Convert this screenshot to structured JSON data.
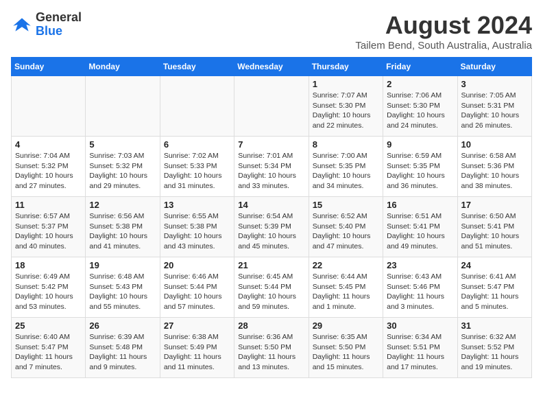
{
  "header": {
    "logo_line1": "General",
    "logo_line2": "Blue",
    "main_title": "August 2024",
    "subtitle": "Tailem Bend, South Australia, Australia"
  },
  "calendar": {
    "days_of_week": [
      "Sunday",
      "Monday",
      "Tuesday",
      "Wednesday",
      "Thursday",
      "Friday",
      "Saturday"
    ],
    "weeks": [
      [
        {
          "day": "",
          "info": ""
        },
        {
          "day": "",
          "info": ""
        },
        {
          "day": "",
          "info": ""
        },
        {
          "day": "",
          "info": ""
        },
        {
          "day": "1",
          "info": "Sunrise: 7:07 AM\nSunset: 5:30 PM\nDaylight: 10 hours\nand 22 minutes."
        },
        {
          "day": "2",
          "info": "Sunrise: 7:06 AM\nSunset: 5:30 PM\nDaylight: 10 hours\nand 24 minutes."
        },
        {
          "day": "3",
          "info": "Sunrise: 7:05 AM\nSunset: 5:31 PM\nDaylight: 10 hours\nand 26 minutes."
        }
      ],
      [
        {
          "day": "4",
          "info": "Sunrise: 7:04 AM\nSunset: 5:32 PM\nDaylight: 10 hours\nand 27 minutes."
        },
        {
          "day": "5",
          "info": "Sunrise: 7:03 AM\nSunset: 5:32 PM\nDaylight: 10 hours\nand 29 minutes."
        },
        {
          "day": "6",
          "info": "Sunrise: 7:02 AM\nSunset: 5:33 PM\nDaylight: 10 hours\nand 31 minutes."
        },
        {
          "day": "7",
          "info": "Sunrise: 7:01 AM\nSunset: 5:34 PM\nDaylight: 10 hours\nand 33 minutes."
        },
        {
          "day": "8",
          "info": "Sunrise: 7:00 AM\nSunset: 5:35 PM\nDaylight: 10 hours\nand 34 minutes."
        },
        {
          "day": "9",
          "info": "Sunrise: 6:59 AM\nSunset: 5:35 PM\nDaylight: 10 hours\nand 36 minutes."
        },
        {
          "day": "10",
          "info": "Sunrise: 6:58 AM\nSunset: 5:36 PM\nDaylight: 10 hours\nand 38 minutes."
        }
      ],
      [
        {
          "day": "11",
          "info": "Sunrise: 6:57 AM\nSunset: 5:37 PM\nDaylight: 10 hours\nand 40 minutes."
        },
        {
          "day": "12",
          "info": "Sunrise: 6:56 AM\nSunset: 5:38 PM\nDaylight: 10 hours\nand 41 minutes."
        },
        {
          "day": "13",
          "info": "Sunrise: 6:55 AM\nSunset: 5:38 PM\nDaylight: 10 hours\nand 43 minutes."
        },
        {
          "day": "14",
          "info": "Sunrise: 6:54 AM\nSunset: 5:39 PM\nDaylight: 10 hours\nand 45 minutes."
        },
        {
          "day": "15",
          "info": "Sunrise: 6:52 AM\nSunset: 5:40 PM\nDaylight: 10 hours\nand 47 minutes."
        },
        {
          "day": "16",
          "info": "Sunrise: 6:51 AM\nSunset: 5:41 PM\nDaylight: 10 hours\nand 49 minutes."
        },
        {
          "day": "17",
          "info": "Sunrise: 6:50 AM\nSunset: 5:41 PM\nDaylight: 10 hours\nand 51 minutes."
        }
      ],
      [
        {
          "day": "18",
          "info": "Sunrise: 6:49 AM\nSunset: 5:42 PM\nDaylight: 10 hours\nand 53 minutes."
        },
        {
          "day": "19",
          "info": "Sunrise: 6:48 AM\nSunset: 5:43 PM\nDaylight: 10 hours\nand 55 minutes."
        },
        {
          "day": "20",
          "info": "Sunrise: 6:46 AM\nSunset: 5:44 PM\nDaylight: 10 hours\nand 57 minutes."
        },
        {
          "day": "21",
          "info": "Sunrise: 6:45 AM\nSunset: 5:44 PM\nDaylight: 10 hours\nand 59 minutes."
        },
        {
          "day": "22",
          "info": "Sunrise: 6:44 AM\nSunset: 5:45 PM\nDaylight: 11 hours\nand 1 minute."
        },
        {
          "day": "23",
          "info": "Sunrise: 6:43 AM\nSunset: 5:46 PM\nDaylight: 11 hours\nand 3 minutes."
        },
        {
          "day": "24",
          "info": "Sunrise: 6:41 AM\nSunset: 5:47 PM\nDaylight: 11 hours\nand 5 minutes."
        }
      ],
      [
        {
          "day": "25",
          "info": "Sunrise: 6:40 AM\nSunset: 5:47 PM\nDaylight: 11 hours\nand 7 minutes."
        },
        {
          "day": "26",
          "info": "Sunrise: 6:39 AM\nSunset: 5:48 PM\nDaylight: 11 hours\nand 9 minutes."
        },
        {
          "day": "27",
          "info": "Sunrise: 6:38 AM\nSunset: 5:49 PM\nDaylight: 11 hours\nand 11 minutes."
        },
        {
          "day": "28",
          "info": "Sunrise: 6:36 AM\nSunset: 5:50 PM\nDaylight: 11 hours\nand 13 minutes."
        },
        {
          "day": "29",
          "info": "Sunrise: 6:35 AM\nSunset: 5:50 PM\nDaylight: 11 hours\nand 15 minutes."
        },
        {
          "day": "30",
          "info": "Sunrise: 6:34 AM\nSunset: 5:51 PM\nDaylight: 11 hours\nand 17 minutes."
        },
        {
          "day": "31",
          "info": "Sunrise: 6:32 AM\nSunset: 5:52 PM\nDaylight: 11 hours\nand 19 minutes."
        }
      ]
    ]
  }
}
